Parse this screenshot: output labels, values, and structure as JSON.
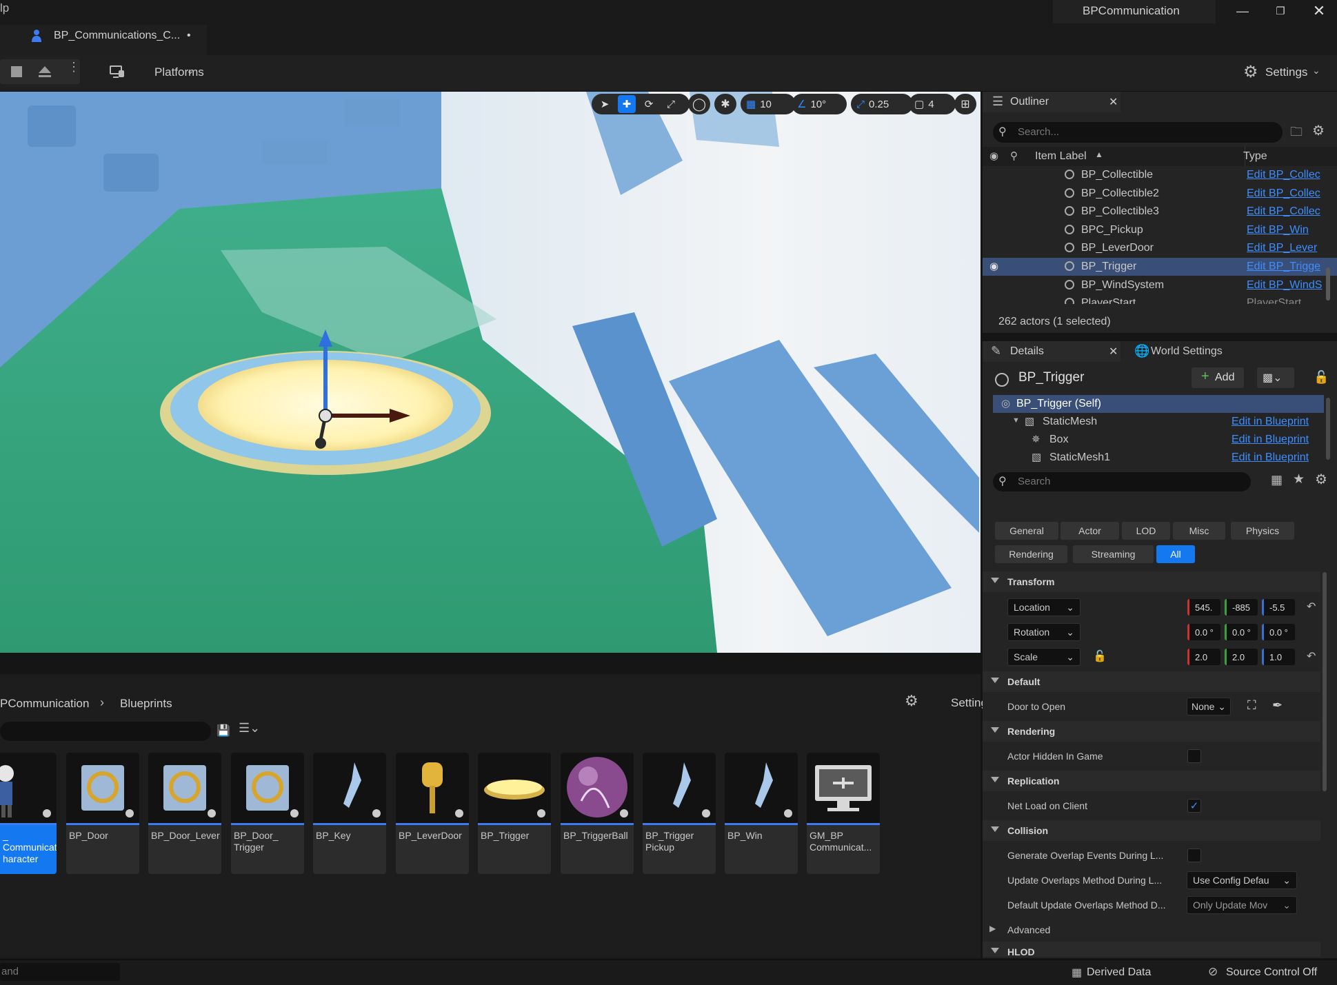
{
  "window": {
    "menu_fragment": "lp",
    "project_title": "BPCommunication",
    "doc_tab": "BP_Communications_C...",
    "doc_tab_modified": "•"
  },
  "toolbar": {
    "platforms_label": "Platforms",
    "settings_label": "Settings"
  },
  "viewport": {
    "grid_snap": "10",
    "rotation_snap": "10°",
    "scale_snap": "0.25",
    "camera_speed": "4"
  },
  "outliner": {
    "title": "Outliner",
    "search_placeholder": "Search...",
    "col_label": "Item Label",
    "col_type": "Type",
    "rows": [
      {
        "name": "BP_Collectible",
        "type": "Edit BP_Collec"
      },
      {
        "name": "BP_Collectible2",
        "type": "Edit BP_Collec"
      },
      {
        "name": "BP_Collectible3",
        "type": "Edit BP_Collec"
      },
      {
        "name": "BPC_Pickup",
        "type": "Edit BP_Win"
      },
      {
        "name": "BP_LeverDoor",
        "type": "Edit BP_Lever"
      },
      {
        "name": "BP_Trigger",
        "type": "Edit BP_Trigge"
      },
      {
        "name": "BP_WindSystem",
        "type": "Edit BP_WindS"
      },
      {
        "name": "PlayerStart",
        "type": "PlayerStart"
      }
    ],
    "footer": "262 actors (1 selected)"
  },
  "details": {
    "tab_details": "Details",
    "tab_world": "World Settings",
    "actor_name": "BP_Trigger",
    "add_label": "Add",
    "components": [
      {
        "name": "BP_Trigger (Self)",
        "link": ""
      },
      {
        "name": "StaticMesh",
        "link": "Edit in Blueprint"
      },
      {
        "name": "Box",
        "link": "Edit in Blueprint"
      },
      {
        "name": "StaticMesh1",
        "link": "Edit in Blueprint"
      }
    ],
    "search_placeholder": "Search",
    "filters": [
      "General",
      "Actor",
      "LOD",
      "Misc",
      "Physics",
      "Rendering",
      "Streaming",
      "All"
    ],
    "sections": {
      "transform": "Transform",
      "default": "Default",
      "rendering": "Rendering",
      "replication": "Replication",
      "collision": "Collision",
      "advanced": "Advanced",
      "hlod": "HLOD"
    },
    "location": {
      "label": "Location",
      "x": "545.",
      "y": "-885",
      "z": "-5.5"
    },
    "rotation": {
      "label": "Rotation",
      "x": "0.0 °",
      "y": "0.0 °",
      "z": "0.0 °"
    },
    "scale": {
      "label": "Scale",
      "x": "2.0",
      "y": "2.0",
      "z": "1.0"
    },
    "door_to_open": {
      "label": "Door to Open",
      "value": "None"
    },
    "actor_hidden": {
      "label": "Actor Hidden In Game",
      "checked": false
    },
    "net_load": {
      "label": "Net Load on Client",
      "checked": true
    },
    "gen_overlap": {
      "label": "Generate Overlap Events During L...",
      "checked": false
    },
    "update_overlaps": {
      "label": "Update Overlaps Method During L...",
      "value": "Use Config Defau"
    },
    "default_update": {
      "label": "Default Update Overlaps Method D...",
      "value": "Only Update Mov"
    }
  },
  "content_browser": {
    "path_root": "PCommunication",
    "path_child": "Blueprints",
    "settings_label": "Settings",
    "assets": [
      {
        "l1": "_",
        "l2": "Communicat...",
        "l3": "haracter"
      },
      {
        "l1": "BP_Door",
        "l2": "",
        "l3": ""
      },
      {
        "l1": "BP_Door_Lever",
        "l2": "",
        "l3": ""
      },
      {
        "l1": "BP_Door_",
        "l2": "Trigger",
        "l3": ""
      },
      {
        "l1": "BP_Key",
        "l2": "",
        "l3": ""
      },
      {
        "l1": "BP_LeverDoor",
        "l2": "",
        "l3": ""
      },
      {
        "l1": "BP_Trigger",
        "l2": "",
        "l3": ""
      },
      {
        "l1": "BP_TriggerBall",
        "l2": "",
        "l3": ""
      },
      {
        "l1": "BP_Trigger",
        "l2": "Pickup",
        "l3": ""
      },
      {
        "l1": "BP_Win",
        "l2": "",
        "l3": ""
      },
      {
        "l1": "GM_BP",
        "l2": "Communicat...",
        "l3": ""
      }
    ]
  },
  "statusbar": {
    "cmd_fragment": "and",
    "derived_data": "Derived Data",
    "source_control": "Source Control Off"
  },
  "colors": {
    "accent": "#1478f0",
    "link": "#3e8eff",
    "panel": "#242424",
    "background": "#151515"
  }
}
